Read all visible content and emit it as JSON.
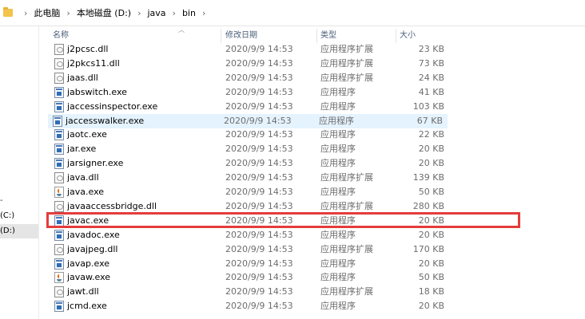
{
  "breadcrumb": [
    "此电脑",
    "本地磁盘 (D:)",
    "java",
    "bin"
  ],
  "breadcrumb_separator": "›",
  "nav": {
    "items": [
      {
        "mark": "-",
        "label": ""
      },
      {
        "mark": "",
        "label": "(C:)"
      },
      {
        "mark": "",
        "label": "(D:)"
      }
    ]
  },
  "columns": {
    "name": "名称",
    "date": "修改日期",
    "type": "类型",
    "size": "大小"
  },
  "files": [
    {
      "name": "j2pcsc.dll",
      "date": "2020/9/9 14:53",
      "type": "应用程序扩展",
      "size": "23 KB",
      "icon": "dll-file-icon"
    },
    {
      "name": "j2pkcs11.dll",
      "date": "2020/9/9 14:53",
      "type": "应用程序扩展",
      "size": "73 KB",
      "icon": "dll-file-icon"
    },
    {
      "name": "jaas.dll",
      "date": "2020/9/9 14:53",
      "type": "应用程序扩展",
      "size": "24 KB",
      "icon": "dll-file-icon"
    },
    {
      "name": "jabswitch.exe",
      "date": "2020/9/9 14:53",
      "type": "应用程序",
      "size": "41 KB",
      "icon": "exe-file-icon"
    },
    {
      "name": "jaccessinspector.exe",
      "date": "2020/9/9 14:53",
      "type": "应用程序",
      "size": "103 KB",
      "icon": "exe-file-icon"
    },
    {
      "name": "jaccesswalker.exe",
      "date": "2020/9/9 14:53",
      "type": "应用程序",
      "size": "67 KB",
      "icon": "exe-file-icon"
    },
    {
      "name": "jaotc.exe",
      "date": "2020/9/9 14:53",
      "type": "应用程序",
      "size": "22 KB",
      "icon": "exe-file-icon"
    },
    {
      "name": "jar.exe",
      "date": "2020/9/9 14:53",
      "type": "应用程序",
      "size": "20 KB",
      "icon": "exe-file-icon"
    },
    {
      "name": "jarsigner.exe",
      "date": "2020/9/9 14:53",
      "type": "应用程序",
      "size": "20 KB",
      "icon": "exe-file-icon"
    },
    {
      "name": "java.dll",
      "date": "2020/9/9 14:53",
      "type": "应用程序扩展",
      "size": "139 KB",
      "icon": "dll-file-icon"
    },
    {
      "name": "java.exe",
      "date": "2020/9/9 14:53",
      "type": "应用程序",
      "size": "50 KB",
      "icon": "java-cup-icon"
    },
    {
      "name": "javaaccessbridge.dll",
      "date": "2020/9/9 14:53",
      "type": "应用程序扩展",
      "size": "280 KB",
      "icon": "dll-file-icon"
    },
    {
      "name": "javac.exe",
      "date": "2020/9/9 14:53",
      "type": "应用程序",
      "size": "20 KB",
      "icon": "exe-file-icon"
    },
    {
      "name": "javadoc.exe",
      "date": "2020/9/9 14:53",
      "type": "应用程序",
      "size": "20 KB",
      "icon": "exe-file-icon"
    },
    {
      "name": "javajpeg.dll",
      "date": "2020/9/9 14:53",
      "type": "应用程序扩展",
      "size": "170 KB",
      "icon": "dll-file-icon"
    },
    {
      "name": "javap.exe",
      "date": "2020/9/9 14:53",
      "type": "应用程序",
      "size": "20 KB",
      "icon": "exe-file-icon"
    },
    {
      "name": "javaw.exe",
      "date": "2020/9/9 14:53",
      "type": "应用程序",
      "size": "50 KB",
      "icon": "java-cup-icon"
    },
    {
      "name": "jawt.dll",
      "date": "2020/9/9 14:53",
      "type": "应用程序扩展",
      "size": "18 KB",
      "icon": "dll-file-icon"
    },
    {
      "name": "jcmd.exe",
      "date": "2020/9/9 14:53",
      "type": "应用程序",
      "size": "20 KB",
      "icon": "exe-file-icon"
    }
  ],
  "hovered_file": "jaccesswalker.exe",
  "highlighted_file": "javac.exe",
  "colors": {
    "highlight_border": "#e43c3c",
    "hover_row": "#e5f3ff",
    "header_text": "#4c607a"
  }
}
